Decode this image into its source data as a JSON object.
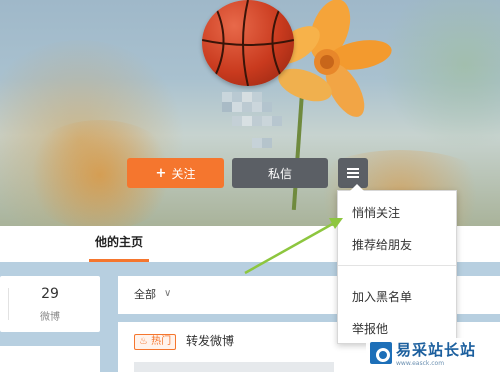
{
  "profile": {
    "follow_label": "关注",
    "follow_icon": "+",
    "message_label": "私信",
    "menu_icon": "hamburger-menu-icon"
  },
  "tabs": {
    "home": "他的主页"
  },
  "stats": {
    "count": "29",
    "label": "微博"
  },
  "feed": {
    "filter_label": "全部",
    "filter_chevron": "chevron-down-icon",
    "hot_badge": "热门",
    "item_title": "转发微博"
  },
  "menu": {
    "items": [
      "悄悄关注",
      "推荐给朋友",
      "加入黑名单",
      "举报他"
    ]
  },
  "watermark": {
    "text": "易采站长站",
    "sub": "www.easck.com"
  },
  "colors": {
    "accent": "#f5762e",
    "button_dark": "#5b5f65",
    "arrow": "#8dc63f"
  }
}
